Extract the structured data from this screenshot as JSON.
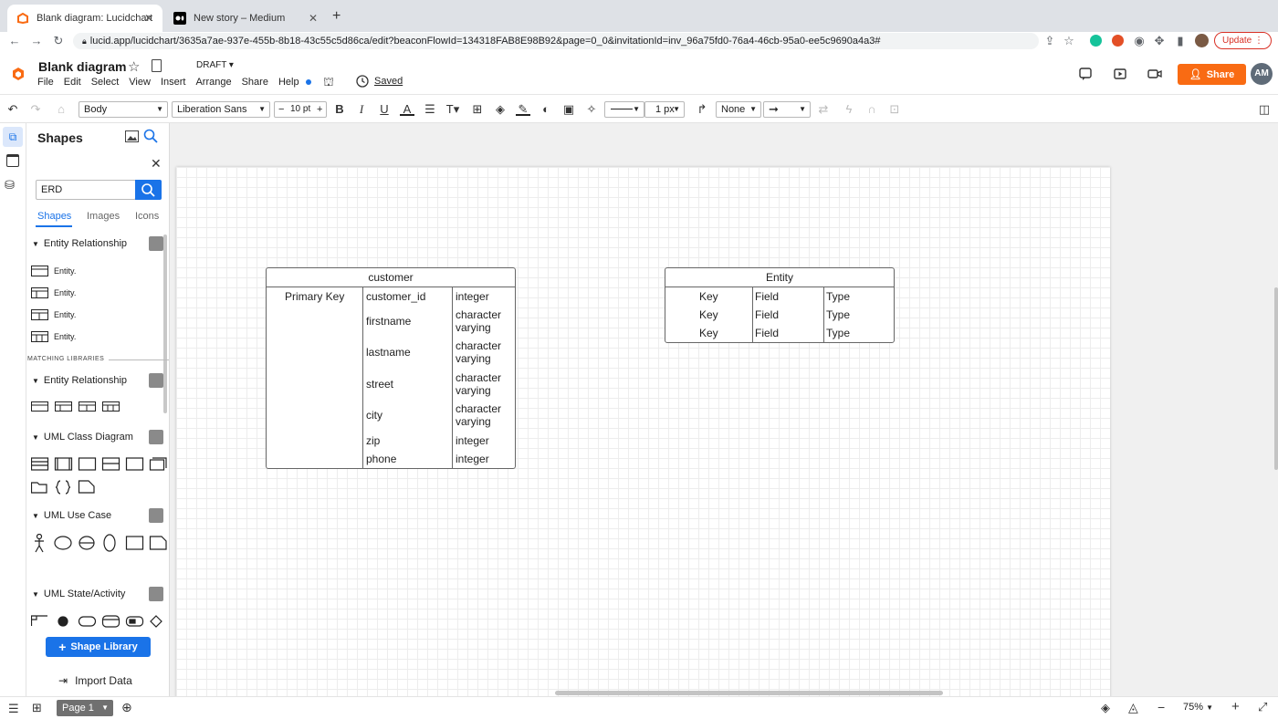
{
  "browser": {
    "tabs": [
      {
        "title": "Blank diagram: Lucidchart"
      },
      {
        "title": "New story – Medium"
      }
    ],
    "url": "lucid.app/lucidchart/3635a7ae-937e-455b-8b18-43c55c5d86ca/edit?beaconFlowId=134318FAB8E98B92&page=0_0&invitationId=inv_96a75fd0-76a4-46cb-95a0-ee5c9690a4a3#",
    "update_label": "Update"
  },
  "header": {
    "title": "Blank diagram",
    "status": "DRAFT",
    "menu": [
      "File",
      "Edit",
      "Select",
      "View",
      "Insert",
      "Arrange",
      "Share",
      "Help"
    ],
    "saved_label": "Saved",
    "share_label": "Share",
    "avatar_initials": "AM",
    "accent_color": "#f96b13"
  },
  "toolbar": {
    "text_style": "Body",
    "font": "Liberation Sans",
    "font_size": "10 pt",
    "line_width": "1 px",
    "endpoint": "None"
  },
  "shapes_panel": {
    "title": "Shapes",
    "search_value": "ERD",
    "tabs": [
      "Shapes",
      "Images",
      "Icons"
    ],
    "section1": "Entity Relationship",
    "entity_items": [
      "Entity.",
      "Entity.",
      "Entity.",
      "Entity."
    ],
    "matching_label": "MATCHING LIBRARIES",
    "section2": "Entity Relationship",
    "section3": "UML Class Diagram",
    "section4": "UML Use Case",
    "section5": "UML State/Activity",
    "library_button": "Shape Library",
    "import_label": "Import Data"
  },
  "canvas": {
    "customer_table": {
      "title": "customer",
      "key_label": "Primary Key",
      "rows": [
        {
          "field": "customer_id",
          "type": "integer"
        },
        {
          "field": "firstname",
          "type": "character varying"
        },
        {
          "field": "lastname",
          "type": "character varying"
        },
        {
          "field": "street",
          "type": "character varying"
        },
        {
          "field": "city",
          "type": "character varying"
        },
        {
          "field": "zip",
          "type": "integer"
        },
        {
          "field": "phone",
          "type": "integer"
        }
      ]
    },
    "entity_table": {
      "title": "Entity",
      "rows": [
        {
          "key": "Key",
          "field": "Field",
          "type": "Type"
        },
        {
          "key": "Key",
          "field": "Field",
          "type": "Type"
        },
        {
          "key": "Key",
          "field": "Field",
          "type": "Type"
        }
      ]
    }
  },
  "bottom": {
    "page_label": "Page 1",
    "zoom": "75%"
  }
}
